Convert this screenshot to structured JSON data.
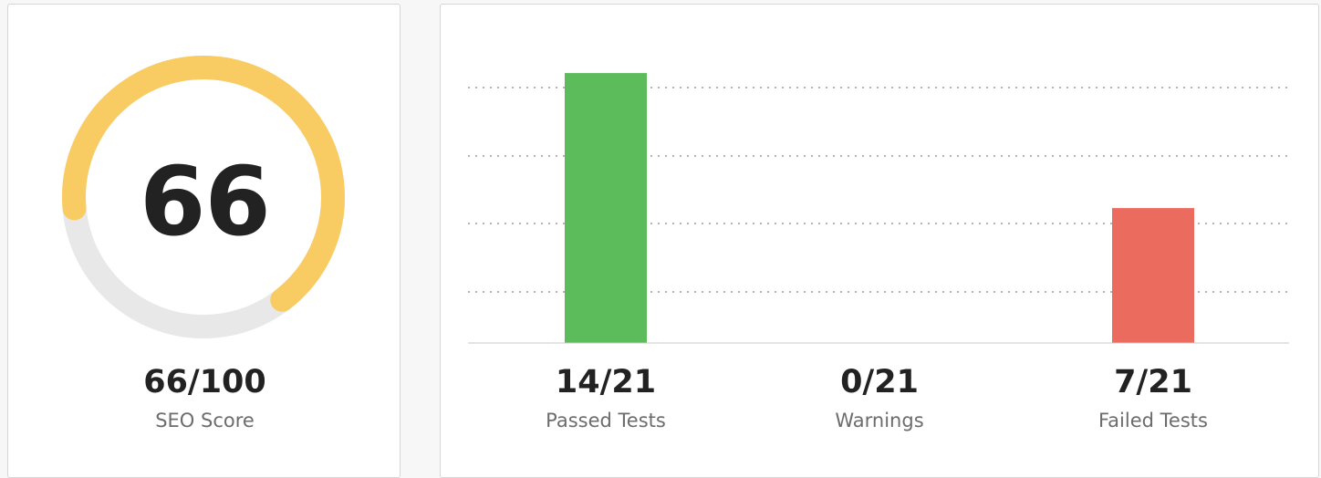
{
  "seo": {
    "score": "66",
    "score_fraction": "66/100",
    "label": "SEO Score",
    "score_value": 66,
    "max_value": 100,
    "gauge_color": "#f8cc63",
    "track_color": "#e8e8e8"
  },
  "chart_data": {
    "type": "bar",
    "categories": [
      "Passed Tests",
      "Warnings",
      "Failed Tests"
    ],
    "values": [
      14,
      0,
      7
    ],
    "value_labels": [
      "14/21",
      "0/21",
      "7/21"
    ],
    "colors": [
      "#5cbb5a",
      "#f8cc63",
      "#ec6b5f"
    ],
    "ylim": [
      0,
      15
    ],
    "grid": "dotted horizontal",
    "title": "",
    "xlabel": "",
    "ylabel": ""
  }
}
